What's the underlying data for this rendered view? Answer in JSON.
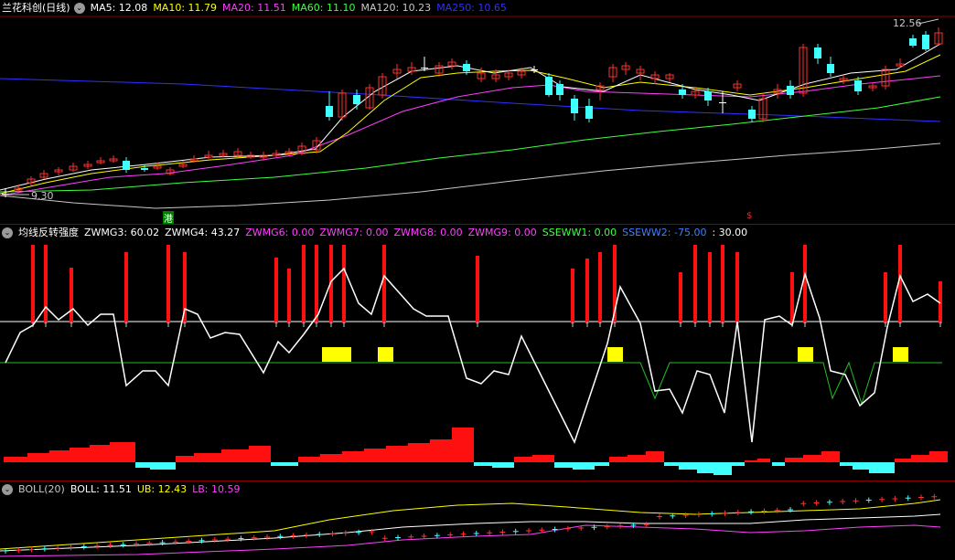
{
  "main": {
    "title": "兰花科创(日线)",
    "indicators": [
      {
        "label": "MA5: 12.08",
        "color": "#ffffff"
      },
      {
        "label": "MA10: 11.79",
        "color": "#ffff00"
      },
      {
        "label": "MA20: 11.51",
        "color": "#ff40ff"
      },
      {
        "label": "MA60: 11.10",
        "color": "#40ff40"
      },
      {
        "label": "MA120: 10.23",
        "color": "#c8c8c8"
      },
      {
        "label": "MA250: 10.65",
        "color": "#3030ff"
      }
    ],
    "high_label": "12.56",
    "low_label": "9.30",
    "marker_gang": "港",
    "marker_dollar": "$"
  },
  "ind": {
    "title": "均线反转强度",
    "items": [
      {
        "label": "ZWMG3: 60.02",
        "color": "#ffffff"
      },
      {
        "label": "ZWMG4: 43.27",
        "color": "#ffffff"
      },
      {
        "label": "ZWMG6: 0.00",
        "color": "#ff40ff"
      },
      {
        "label": "ZWMG7: 0.00",
        "color": "#ff40ff"
      },
      {
        "label": "ZWMG8: 0.00",
        "color": "#ff40ff"
      },
      {
        "label": "ZWMG9: 0.00",
        "color": "#ff40ff"
      },
      {
        "label": "SSEWW1: 0.00",
        "color": "#40ff40"
      },
      {
        "label": "SSEWW2: -75.00",
        "color": "#4080ff"
      },
      {
        "label": ": 30.00",
        "color": "#ffffff"
      }
    ]
  },
  "boll": {
    "title": "BOLL(20)",
    "items": [
      {
        "label": "BOLL: 11.51",
        "color": "#ffffff"
      },
      {
        "label": "UB: 12.43",
        "color": "#ffff00"
      },
      {
        "label": "LB: 10.59",
        "color": "#ff40ff"
      }
    ]
  }
}
